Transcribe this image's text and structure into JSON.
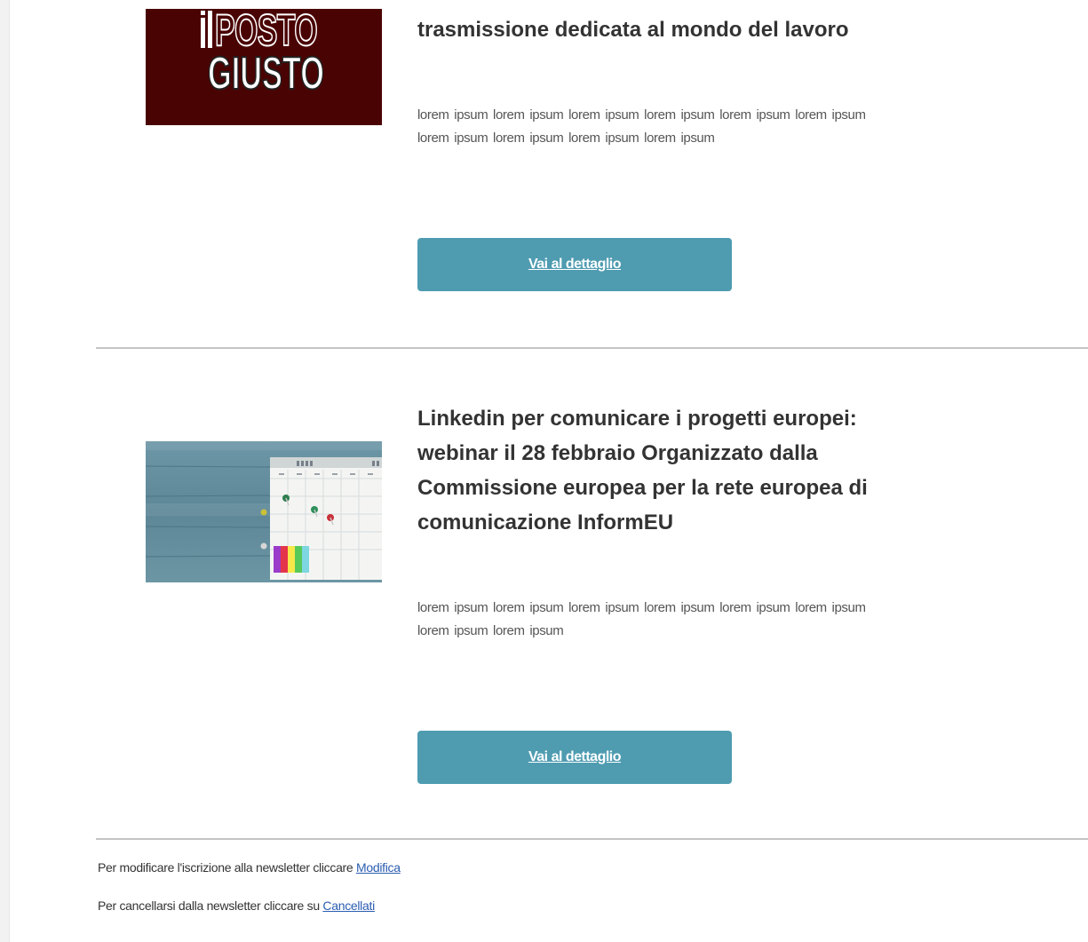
{
  "articles": [
    {
      "thumbnail": {
        "kind": "logo",
        "logo_text_top": "POSTO",
        "logo_text_bottom": "GIUSTO",
        "background": "#4a0303"
      },
      "title": "trasmissione dedicata al mondo del lavoro",
      "summary": "lorem ipsum   lorem ipsum   lorem ipsum   lorem ipsum   lorem ipsum lorem ipsum   lorem ipsum   lorem ipsum   lorem ipsum   lorem ipsum",
      "button_label": "Vai al dettaglio"
    },
    {
      "thumbnail": {
        "kind": "calendar-photo"
      },
      "title": "Linkedin per comunicare i progetti europei: webinar il 28 febbraio Organizzato dalla Commissione europea per la rete europea di comunicazione InformEU",
      "summary": "lorem ipsum   lorem ipsum   lorem ipsum   lorem ipsum   lorem ipsum lorem ipsum   lorem ipsum   lorem ipsum",
      "button_label": "Vai al dettaglio"
    }
  ],
  "footer": {
    "modify_text": "Per modificare l'iscrizione alla newsletter cliccare",
    "modify_link": "Modifica",
    "cancel_text": "Per cancellarsi dalla newsletter cliccare su",
    "cancel_link": "Cancellati"
  },
  "colors": {
    "button": "#4f9cb1",
    "divider": "#c4c4c4",
    "link": "#2a5db0",
    "title": "#333333"
  }
}
